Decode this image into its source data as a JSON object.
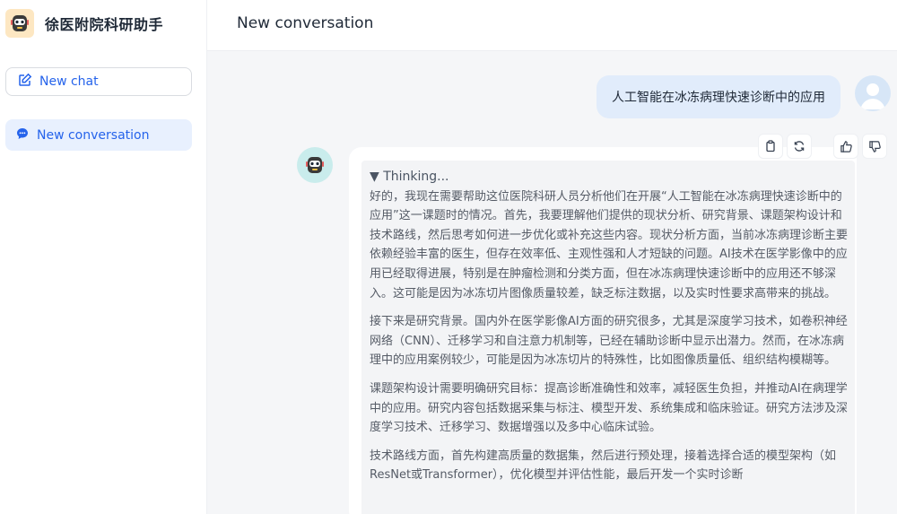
{
  "sidebar": {
    "brand_title": "徐医附院科研助手",
    "new_chat_label": "New chat",
    "conversations": [
      {
        "label": "New conversation"
      }
    ]
  },
  "header": {
    "title": "New conversation"
  },
  "messages": {
    "user_text": "人工智能在冰冻病理快速诊断中的应用",
    "thinking_label": "▼ Thinking...",
    "paragraphs": [
      "好的，我现在需要帮助这位医院科研人员分析他们在开展“人工智能在冰冻病理快速诊断中的应用”这一课题时的情况。首先，我要理解他们提供的现状分析、研究背景、课题架构设计和技术路线，然后思考如何进一步优化或补充这些内容。现状分析方面，当前冰冻病理诊断主要依赖经验丰富的医生，但存在效率低、主观性强和人才短缺的问题。AI技术在医学影像中的应用已经取得进展，特别是在肿瘤检测和分类方面，但在冰冻病理快速诊断中的应用还不够深入。这可能是因为冰冻切片图像质量较差，缺乏标注数据，以及实时性要求高带来的挑战。",
      "接下来是研究背景。国内外在医学影像AI方面的研究很多，尤其是深度学习技术，如卷积神经网络（CNN）、迁移学习和自注意力机制等，已经在辅助诊断中显示出潜力。然而，在冰冻病理中的应用案例较少，可能是因为冰冻切片的特殊性，比如图像质量低、组织结构模糊等。",
      "课题架构设计需要明确研究目标：提高诊断准确性和效率，减轻医生负担，并推动AI在病理学中的应用。研究内容包括数据采集与标注、模型开发、系统集成和临床验证。研究方法涉及深度学习技术、迁移学习、数据增强以及多中心临床试验。",
      "技术路线方面，首先构建高质量的数据集，然后进行预处理，接着选择合适的模型架构（如ResNet或Transformer），优化模型并评估性能，最后开发一个实时诊断"
    ]
  },
  "colors": {
    "accent": "#2563eb",
    "user_bubble": "#e1ecfb",
    "thinking_bg": "#f3f4f6"
  },
  "icons": {
    "brand": "robot-logo-icon",
    "new_chat": "edit-icon",
    "conversation": "chat-bubble-icon",
    "actions": [
      "copy-icon",
      "refresh-icon",
      "thumbs-up-icon",
      "thumbs-down-icon"
    ]
  }
}
